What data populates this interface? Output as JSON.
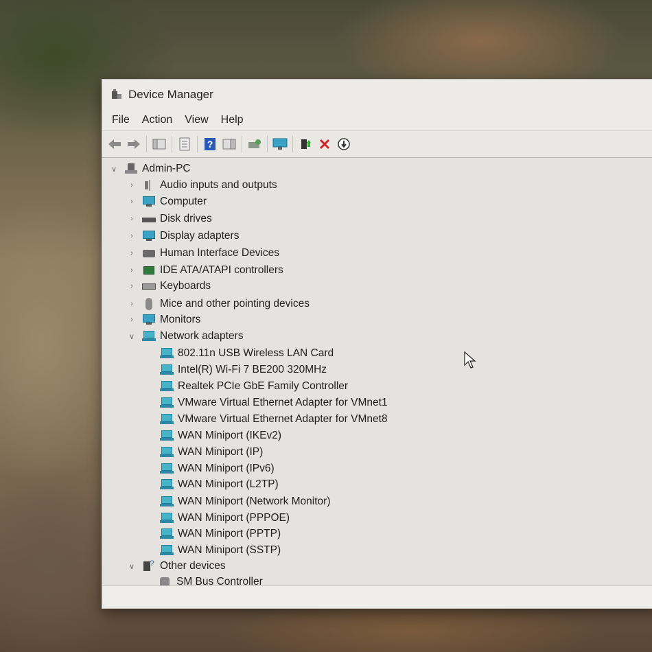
{
  "window": {
    "title": "Device Manager"
  },
  "menu": {
    "file": "File",
    "action": "Action",
    "view": "View",
    "help": "Help"
  },
  "tree": {
    "root": "Admin-PC",
    "categories": [
      "Audio inputs and outputs",
      "Computer",
      "Disk drives",
      "Display adapters",
      "Human Interface Devices",
      "IDE ATA/ATAPI controllers",
      "Keyboards",
      "Mice and other pointing devices",
      "Monitors",
      "Network adapters"
    ],
    "network_adapters": [
      "802.11n USB Wireless LAN Card",
      "Intel(R) Wi-Fi 7 BE200 320MHz",
      "Realtek PCIe GbE Family Controller",
      "VMware Virtual Ethernet Adapter for VMnet1",
      "VMware Virtual Ethernet Adapter for VMnet8",
      "WAN Miniport (IKEv2)",
      "WAN Miniport (IP)",
      "WAN Miniport (IPv6)",
      "WAN Miniport (L2TP)",
      "WAN Miniport (Network Monitor)",
      "WAN Miniport (PPPOE)",
      "WAN Miniport (PPTP)",
      "WAN Miniport (SSTP)"
    ],
    "other_devices": "Other devices",
    "other_devices_children": [
      "SM Bus Controller"
    ]
  },
  "colors": {
    "remove_icon": "#d22222",
    "help_icon": "#2a58b8"
  }
}
